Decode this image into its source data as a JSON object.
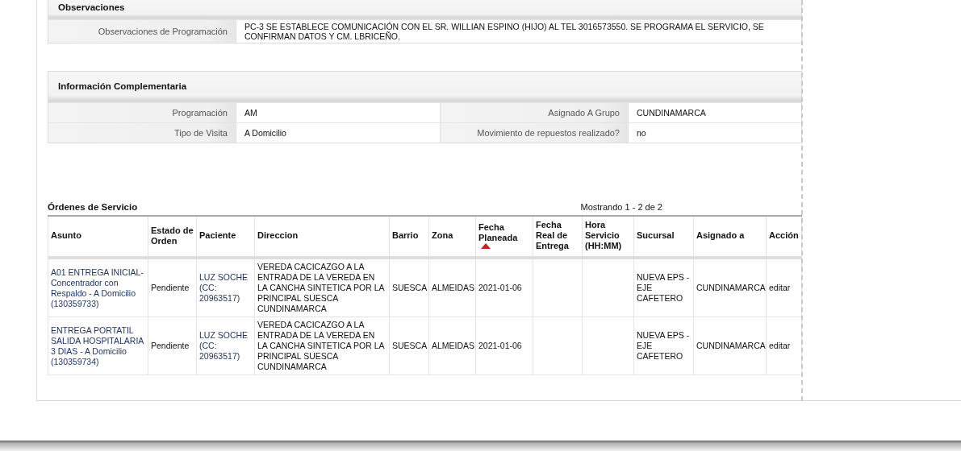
{
  "observaciones": {
    "title": "Observaciones",
    "rows": [
      {
        "label": "Observaciones de Programación",
        "value": "PC-3 SE ESTABLECE COMUNICACIÓN CON EL SR. WILLIAN ESPINO (HIJO) AL TEL 3016573550. SE PROGRAMA EL SERVICIO, SE CONFIRMAN DATOS Y CM. LBRICEÑO."
      }
    ]
  },
  "informacion": {
    "title": "Información Complementaria",
    "rows": [
      [
        {
          "label": "Programación",
          "value": "AM"
        },
        {
          "label": "Asignado A Grupo",
          "value": "CUNDINAMARCA"
        }
      ],
      [
        {
          "label": "Tipo de Visita",
          "value": "A Domicilio"
        },
        {
          "label": "Movimiento de repuestos realizado?",
          "value": "no"
        }
      ]
    ]
  },
  "ordenes": {
    "title": "Órdenes de Servicio",
    "paging": "Mostrando 1 - 2 de 2",
    "columns": [
      {
        "label": "Asunto",
        "sorted": false
      },
      {
        "label": "Estado de Orden",
        "sorted": false
      },
      {
        "label": "Paciente",
        "sorted": false
      },
      {
        "label": "Direccion",
        "sorted": false
      },
      {
        "label": "Barrio",
        "sorted": false
      },
      {
        "label": "Zona",
        "sorted": false
      },
      {
        "label": "Fecha Planeada",
        "sorted": true
      },
      {
        "label": "Fecha Real de Entrega",
        "sorted": false
      },
      {
        "label": "Hora Servicio (HH:MM)",
        "sorted": false
      },
      {
        "label": "Sucursal",
        "sorted": false
      },
      {
        "label": "Asignado a",
        "sorted": false
      },
      {
        "label": "Acción",
        "sorted": false
      }
    ],
    "rows": [
      {
        "asunto": "A01 ENTREGA INICIAL-Concentrador con Respaldo - A Domicilio (130359733)",
        "estado": "Pendiente",
        "paciente": "LUZ SOCHE (CC: 20963517)",
        "direccion": "VEREDA CACICAZGO A LA ENTRADA DE LA VEREDA EN LA CANCHA SINTETICA POR LA PRINCIPAL SUESCA CUNDINAMARCA",
        "barrio": "SUESCA",
        "zona": "ALMEIDAS",
        "fecha_planeada": "2021-01-06",
        "sucursal": "NUEVA EPS - EJE CAFETERO",
        "asignado": "CUNDINAMARCA",
        "accion": "editar"
      },
      {
        "asunto": "ENTREGA PORTATIL SALIDA HOSPITALARIA 3 DIAS - A Domicilio (130359734)",
        "estado": "Pendiente",
        "paciente": "LUZ SOCHE (CC: 20963517)",
        "direccion": "VEREDA CACICAZGO A LA ENTRADA DE LA VEREDA EN LA CANCHA SINTETICA POR LA PRINCIPAL SUESCA CUNDINAMARCA",
        "barrio": "SUESCA",
        "zona": "ALMEIDAS",
        "fecha_planeada": "2021-01-06",
        "sucursal": "NUEVA EPS - EJE CAFETERO",
        "asignado": "CUNDINAMARCA",
        "accion": "editar"
      }
    ]
  }
}
